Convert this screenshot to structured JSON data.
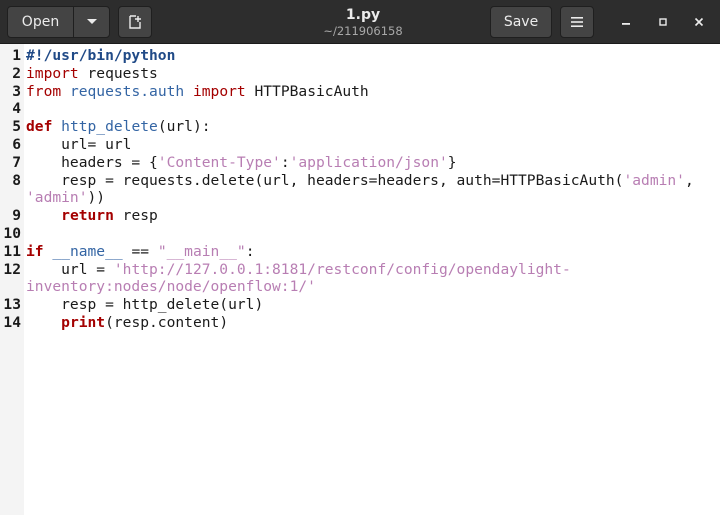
{
  "header": {
    "open_label": "Open",
    "save_label": "Save",
    "title": "1.py",
    "subtitle": "~/211906158",
    "icons": [
      "chevron-down-icon",
      "new-document-icon",
      "menu-icon",
      "minimize-icon",
      "maximize-icon",
      "close-icon"
    ]
  },
  "code": [
    {
      "n": "1",
      "cont": [
        [
          {
            "c": "shebang",
            "t": "#!/usr/bin/python"
          }
        ]
      ]
    },
    {
      "n": "2",
      "cont": [
        [
          {
            "c": "imp",
            "t": "import"
          },
          {
            "c": "",
            "t": " requests"
          }
        ]
      ]
    },
    {
      "n": "3",
      "cont": [
        [
          {
            "c": "imp",
            "t": "from"
          },
          {
            "c": "",
            "t": " "
          },
          {
            "c": "func",
            "t": "requests.auth"
          },
          {
            "c": "",
            "t": " "
          },
          {
            "c": "imp",
            "t": "import"
          },
          {
            "c": "",
            "t": " HTTPBasicAuth"
          }
        ]
      ]
    },
    {
      "n": "4",
      "cont": [
        [
          {
            "c": "",
            "t": ""
          }
        ]
      ]
    },
    {
      "n": "5",
      "cont": [
        [
          {
            "c": "kw",
            "t": "def"
          },
          {
            "c": "",
            "t": " "
          },
          {
            "c": "func",
            "t": "http_delete"
          },
          {
            "c": "",
            "t": "(url):"
          }
        ]
      ]
    },
    {
      "n": "6",
      "cont": [
        [
          {
            "c": "",
            "t": "    url= url"
          }
        ]
      ]
    },
    {
      "n": "7",
      "cont": [
        [
          {
            "c": "",
            "t": "    headers = {"
          },
          {
            "c": "str",
            "t": "'Content-Type'"
          },
          {
            "c": "",
            "t": ":"
          },
          {
            "c": "str",
            "t": "'application/json'"
          },
          {
            "c": "",
            "t": "}"
          }
        ]
      ]
    },
    {
      "n": "8",
      "cont": [
        [
          {
            "c": "",
            "t": "    resp = requests.delete(url, headers=headers, auth=HTTPBasicAuth("
          },
          {
            "c": "str",
            "t": "'admin'"
          },
          {
            "c": "",
            "t": ","
          }
        ],
        [
          {
            "c": "str",
            "t": "'admin'"
          },
          {
            "c": "",
            "t": "))"
          }
        ]
      ]
    },
    {
      "n": "9",
      "cont": [
        [
          {
            "c": "",
            "t": "    "
          },
          {
            "c": "kw",
            "t": "return"
          },
          {
            "c": "",
            "t": " resp"
          }
        ]
      ]
    },
    {
      "n": "10",
      "cont": [
        [
          {
            "c": "",
            "t": ""
          }
        ]
      ]
    },
    {
      "n": "11",
      "cont": [
        [
          {
            "c": "kw",
            "t": "if"
          },
          {
            "c": "",
            "t": " "
          },
          {
            "c": "func",
            "t": "__name__"
          },
          {
            "c": "",
            "t": " == "
          },
          {
            "c": "str",
            "t": "\"__main__\""
          },
          {
            "c": "",
            "t": ":"
          }
        ]
      ]
    },
    {
      "n": "12",
      "cont": [
        [
          {
            "c": "",
            "t": "    url = "
          },
          {
            "c": "str",
            "t": "'http://127.0.0.1:8181/restconf/config/opendaylight-"
          }
        ],
        [
          {
            "c": "str",
            "t": "inventory:nodes/node/openflow:1/'"
          }
        ]
      ]
    },
    {
      "n": "13",
      "cont": [
        [
          {
            "c": "",
            "t": "    resp = http_delete(url)"
          }
        ]
      ]
    },
    {
      "n": "14",
      "cont": [
        [
          {
            "c": "",
            "t": "    "
          },
          {
            "c": "kw",
            "t": "print"
          },
          {
            "c": "",
            "t": "(resp.content)"
          }
        ]
      ]
    }
  ]
}
